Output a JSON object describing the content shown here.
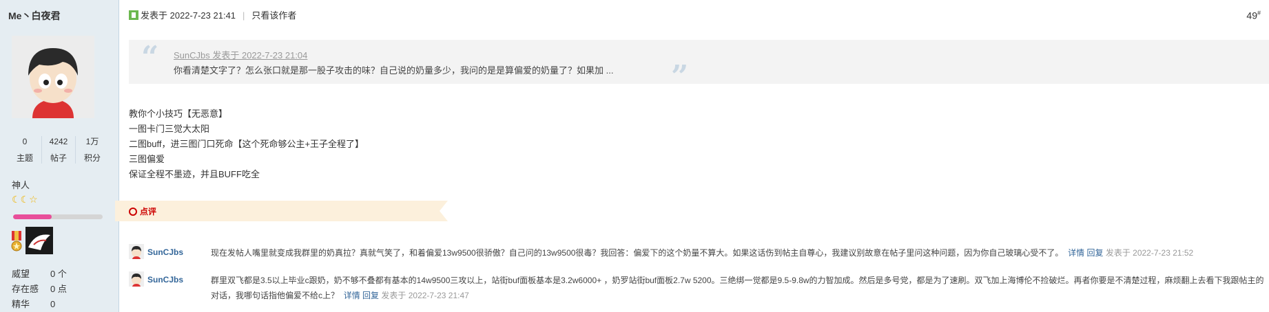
{
  "user": {
    "name": "Me丶白夜君",
    "stats": [
      {
        "num": "0",
        "label": "主题"
      },
      {
        "num": "4242",
        "label": "帖子"
      },
      {
        "num": "1万",
        "label": "积分"
      }
    ],
    "rank": "神人",
    "level_icons": [
      "moon-icon",
      "moon-icon",
      "star-icon"
    ],
    "progress_fraction": 0.43,
    "medals": [
      "ribbon-medal-icon",
      "character-medal-icon"
    ],
    "info": [
      {
        "k": "威望",
        "v": "0 个"
      },
      {
        "k": "存在感",
        "v": "0 点"
      },
      {
        "k": "精华",
        "v": "0"
      }
    ]
  },
  "post": {
    "posted": "发表于 2022-7-23 21:41",
    "only_author": "只看该作者",
    "floor": "49",
    "floor_mark": "#",
    "quote": {
      "author_line": "SunCJbs 发表于 2022-7-23 21:04",
      "text": "你看清楚文字了？怎么张口就是那一股子攻击的味？自己说的奶量多少，我问的是是算偏爱的奶量了？如果加 ..."
    },
    "body": [
      "教你个小技巧【无恶意】",
      "一图卡门三觉大太阳",
      "二图buff，进三图门口死命【这个死命够公主+王子全程了】",
      "三图偏爱",
      "保证全程不墨迹，并且BUFF吃全"
    ],
    "review_label": "点评",
    "comments": [
      {
        "name": "SunCJbs",
        "text": "现在发帖人嘴里就变成我群里的奶真拉？真就气笑了，和着偏爱13w9500很骄傲？自己问的13w9500很毒？我回答：偏爱下的这个奶量不算大。如果这话伤到帖主自尊心，我建议别故意在帖子里问这种问题，因为你自己玻璃心受不了。",
        "detail": "详情",
        "reply": "回复",
        "time": "发表于 2022-7-23 21:52"
      },
      {
        "name": "SunCJbs",
        "text": "群里双飞都是3.5以上毕业c跟奶，奶不够不叠都有基本的14w9500三攻以上，站街buf面板基本是3.2w6000+ ，奶罗站街buf面板2.7w 5200。三绝绑一觉都是9.5-9.8w的力智加成。然后是多号党，都是为了速刷。双飞加上海博伦不捡破烂。再者你要是不清楚过程，麻烦翻上去看下我跟帖主的对话，我哪句话指他偏爱不给c上？",
        "detail": "详情",
        "reply": "回复",
        "time": "发表于 2022-7-23 21:47"
      }
    ]
  },
  "colors": {
    "sidebar_bg": "#e5edf2",
    "link": "#336699",
    "progress": "#e84f9a",
    "ribbon": "#fcf0dc",
    "review_red": "#cc0000"
  }
}
